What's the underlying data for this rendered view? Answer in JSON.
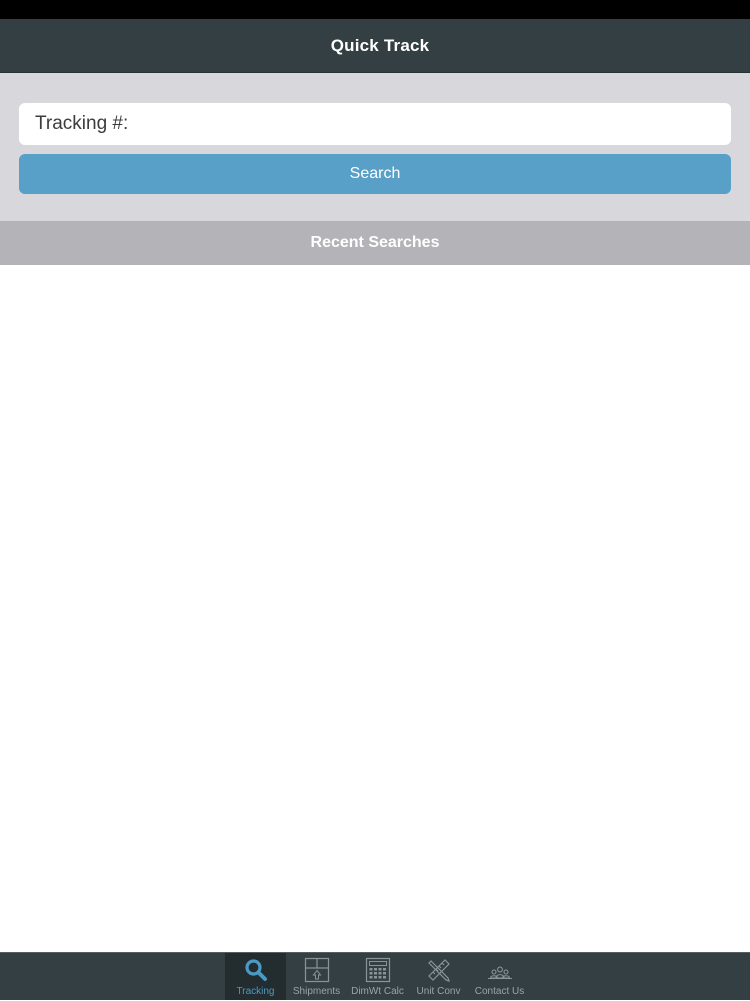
{
  "nav": {
    "title": "Quick Track"
  },
  "search": {
    "placeholder": "Tracking #:",
    "value": "",
    "button_label": "Search"
  },
  "recent": {
    "title": "Recent Searches",
    "items": []
  },
  "tabs": [
    {
      "label": "Tracking",
      "icon": "search-icon",
      "active": true
    },
    {
      "label": "Shipments",
      "icon": "package-icon",
      "active": false
    },
    {
      "label": "DimWt Calc",
      "icon": "calculator-icon",
      "active": false
    },
    {
      "label": "Unit Conv",
      "icon": "ruler-pencil-icon",
      "active": false
    },
    {
      "label": "Contact Us",
      "icon": "people-icon",
      "active": false
    }
  ],
  "colors": {
    "nav_bg": "#333f42",
    "accent": "#58a0c8",
    "active_tab_text": "#4a9ac4",
    "section_header_bg": "#b4b4b8",
    "search_area_bg": "#d8d8dc"
  }
}
